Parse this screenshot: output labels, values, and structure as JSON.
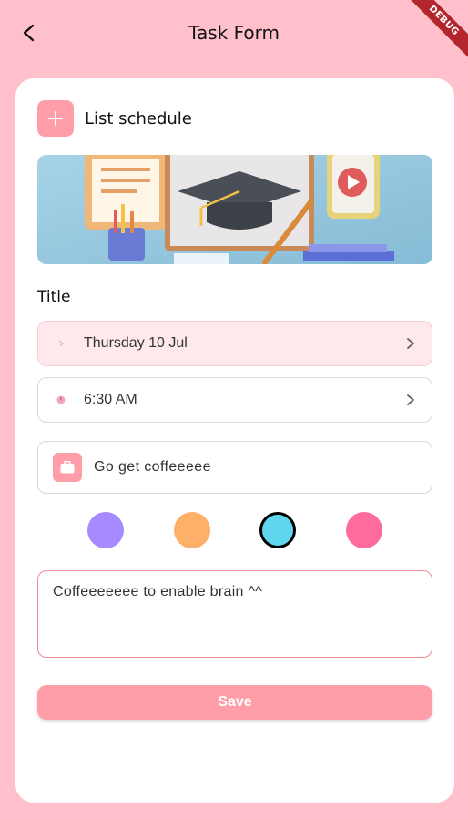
{
  "appbar": {
    "title": "Task Form",
    "back_icon": "chevron-left-icon",
    "debug_label": "DEBUG"
  },
  "header": {
    "label": "List schedule",
    "icon": "plus-icon"
  },
  "form": {
    "title_label": "Title",
    "date_value": "Thursday 10 Jul",
    "time_value": "6:30 AM",
    "task_value": "Go get coffeeeee",
    "task_icon": "briefcase-icon",
    "note_value": "Coffeeeeeee to enable brain ^^",
    "save_label": "Save"
  },
  "colors": {
    "options": [
      "#a58bff",
      "#ffb068",
      "#5fd6ee",
      "#ff6b9a"
    ],
    "selected_index": 2,
    "accent": "#ff9ea8",
    "background": "#ffc0cb"
  }
}
